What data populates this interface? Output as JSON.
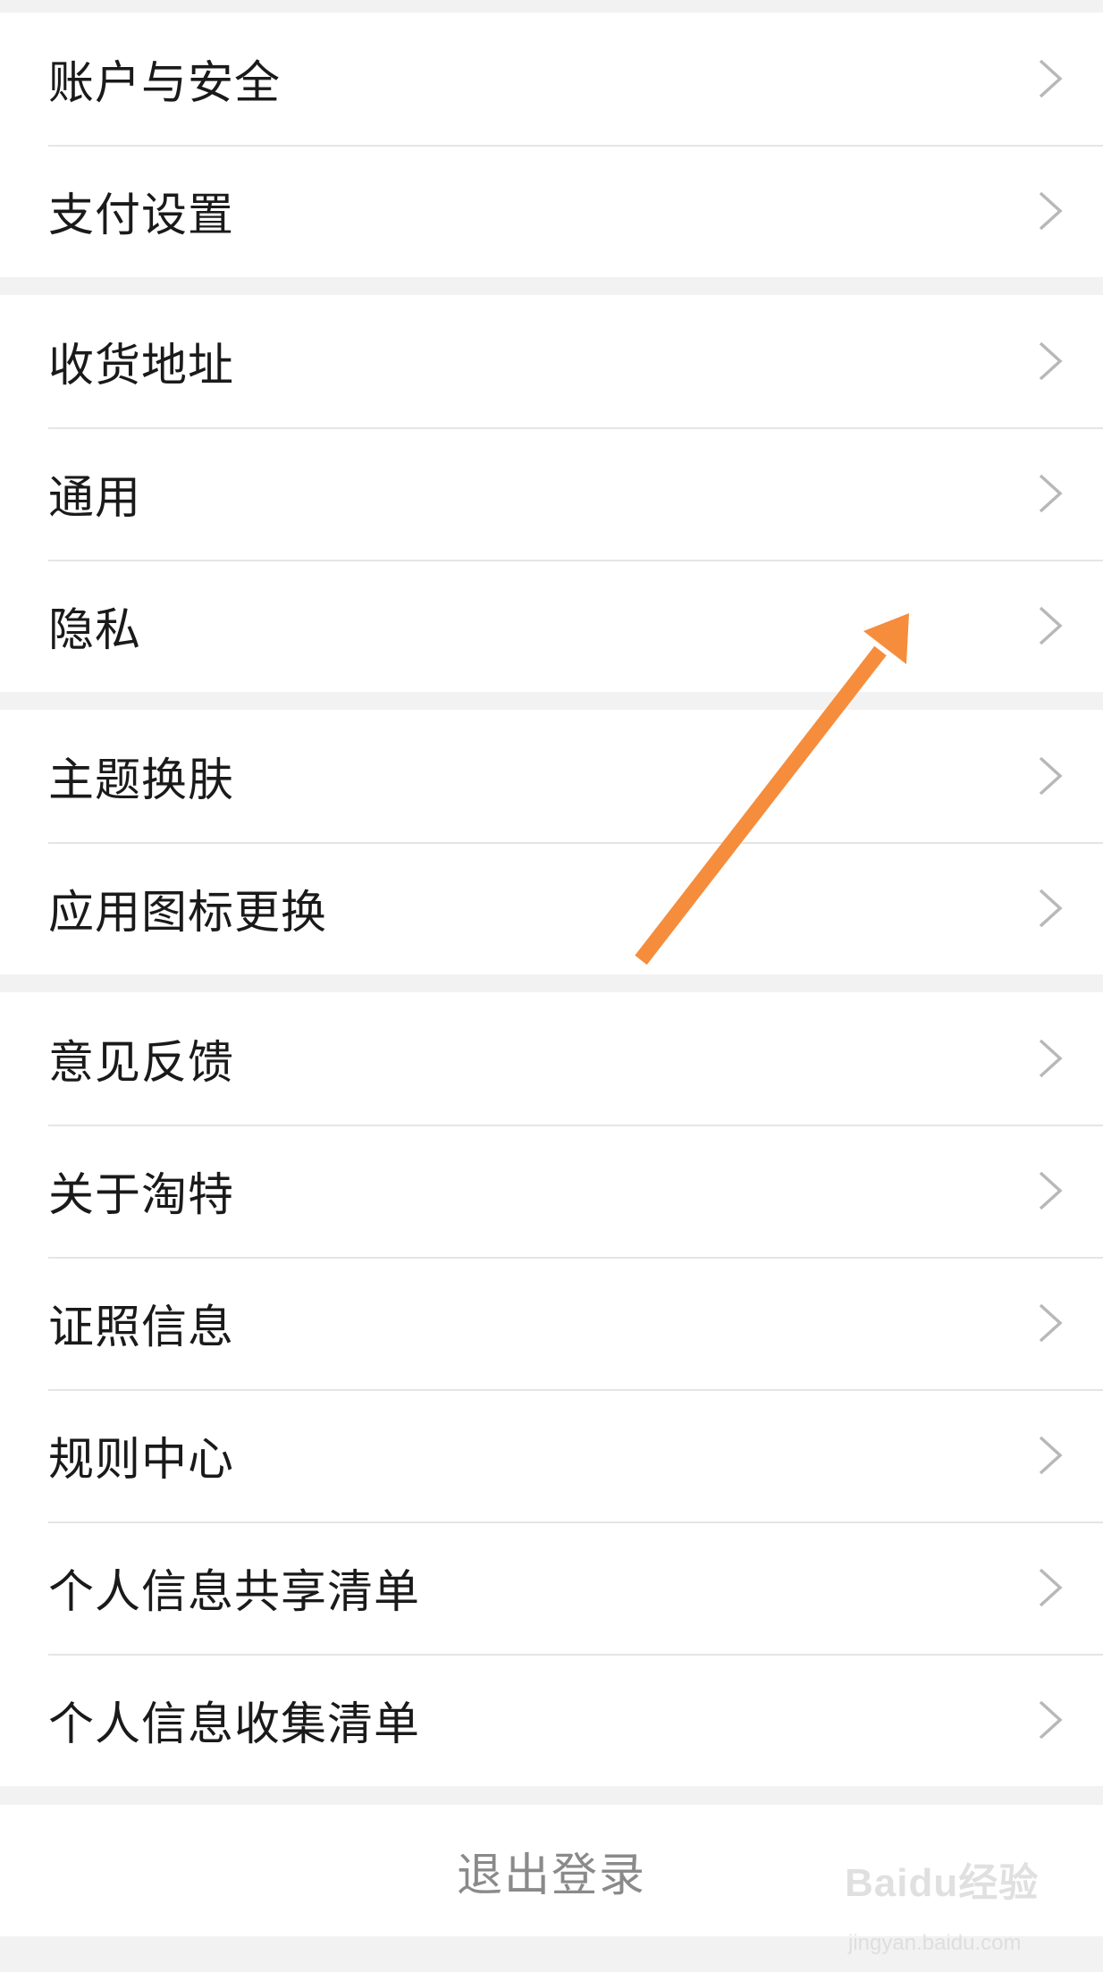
{
  "settings": {
    "groups": [
      {
        "items": [
          {
            "label": "账户与安全"
          },
          {
            "label": "支付设置"
          }
        ]
      },
      {
        "items": [
          {
            "label": "收货地址"
          },
          {
            "label": "通用"
          },
          {
            "label": "隐私"
          }
        ]
      },
      {
        "items": [
          {
            "label": "主题换肤"
          },
          {
            "label": "应用图标更换"
          }
        ]
      },
      {
        "items": [
          {
            "label": "意见反馈"
          },
          {
            "label": "关于淘特"
          },
          {
            "label": "证照信息"
          },
          {
            "label": "规则中心"
          },
          {
            "label": "个人信息共享清单"
          },
          {
            "label": "个人信息收集清单"
          }
        ]
      }
    ],
    "logout_label": "退出登录"
  },
  "annotation": {
    "color": "#f58d3c"
  },
  "watermark": {
    "brand": "Baidu经验",
    "sub": "jingyan.baidu.com"
  },
  "colors": {
    "background": "#f2f2f2",
    "row": "#ffffff",
    "chevron": "#b8b8b8",
    "logout_text": "#8a8a8a"
  }
}
